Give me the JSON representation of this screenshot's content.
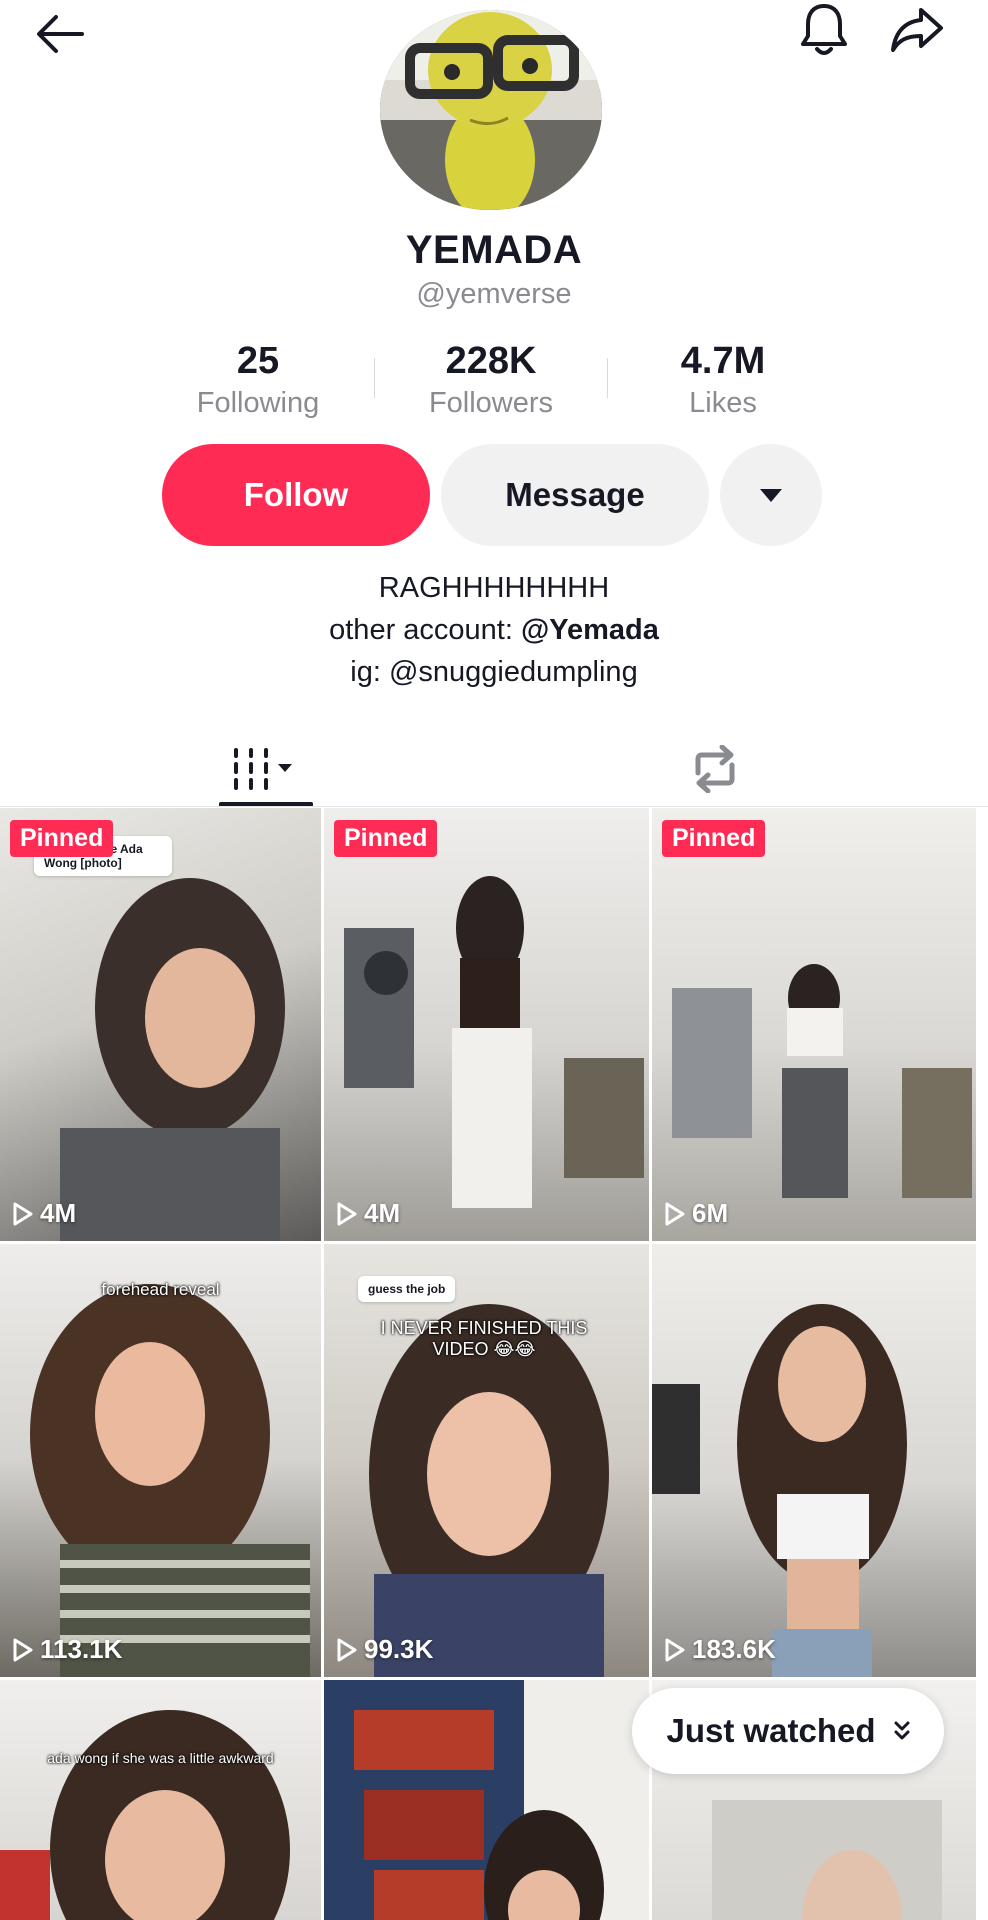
{
  "header": {
    "back_icon": "arrow-left-icon",
    "bell_icon": "bell-icon",
    "share_icon": "share-arrow-icon"
  },
  "profile": {
    "display_name": "YEMADA",
    "username": "@yemverse",
    "stats": [
      {
        "value": "25",
        "label": "Following"
      },
      {
        "value": "228K",
        "label": "Followers"
      },
      {
        "value": "4.7M",
        "label": "Likes"
      }
    ]
  },
  "actions": {
    "follow_label": "Follow",
    "message_label": "Message",
    "more_icon": "caret-down-icon"
  },
  "bio": {
    "line1": "RAGHHHHHHHH",
    "line2_prefix": "other account: ",
    "line2_link": "@Yemada",
    "line3": "ig: @snuggiedumpling"
  },
  "tabs": {
    "videos_icon": "videos-grid-icon",
    "repost_icon": "repost-icon"
  },
  "videos": [
    {
      "pinned": "Pinned",
      "views": "4M",
      "caption": "",
      "bubble": "You look like Ada Wong [photo]"
    },
    {
      "pinned": "Pinned",
      "views": "4M",
      "caption": ""
    },
    {
      "pinned": "Pinned",
      "views": "6M",
      "caption": ""
    },
    {
      "pinned": "",
      "views": "113.1K",
      "caption": "forehead reveal"
    },
    {
      "pinned": "",
      "views": "99.3K",
      "caption": "I NEVER FINISHED THIS VIDEO 😂😂",
      "bubble": "guess the job"
    },
    {
      "pinned": "",
      "views": "183.6K",
      "caption": ""
    },
    {
      "pinned": "",
      "views": "",
      "caption": "ada wong if she was a little awkward"
    },
    {
      "pinned": "",
      "views": "",
      "caption": ""
    },
    {
      "pinned": "",
      "views": "",
      "caption": ""
    }
  ],
  "just_watched": {
    "label": "Just watched",
    "icon": "double-chevron-down-icon"
  },
  "colors": {
    "accent": "#fe2c55",
    "secondary_button": "#f1f1f2",
    "muted_text": "#8a8b91"
  }
}
